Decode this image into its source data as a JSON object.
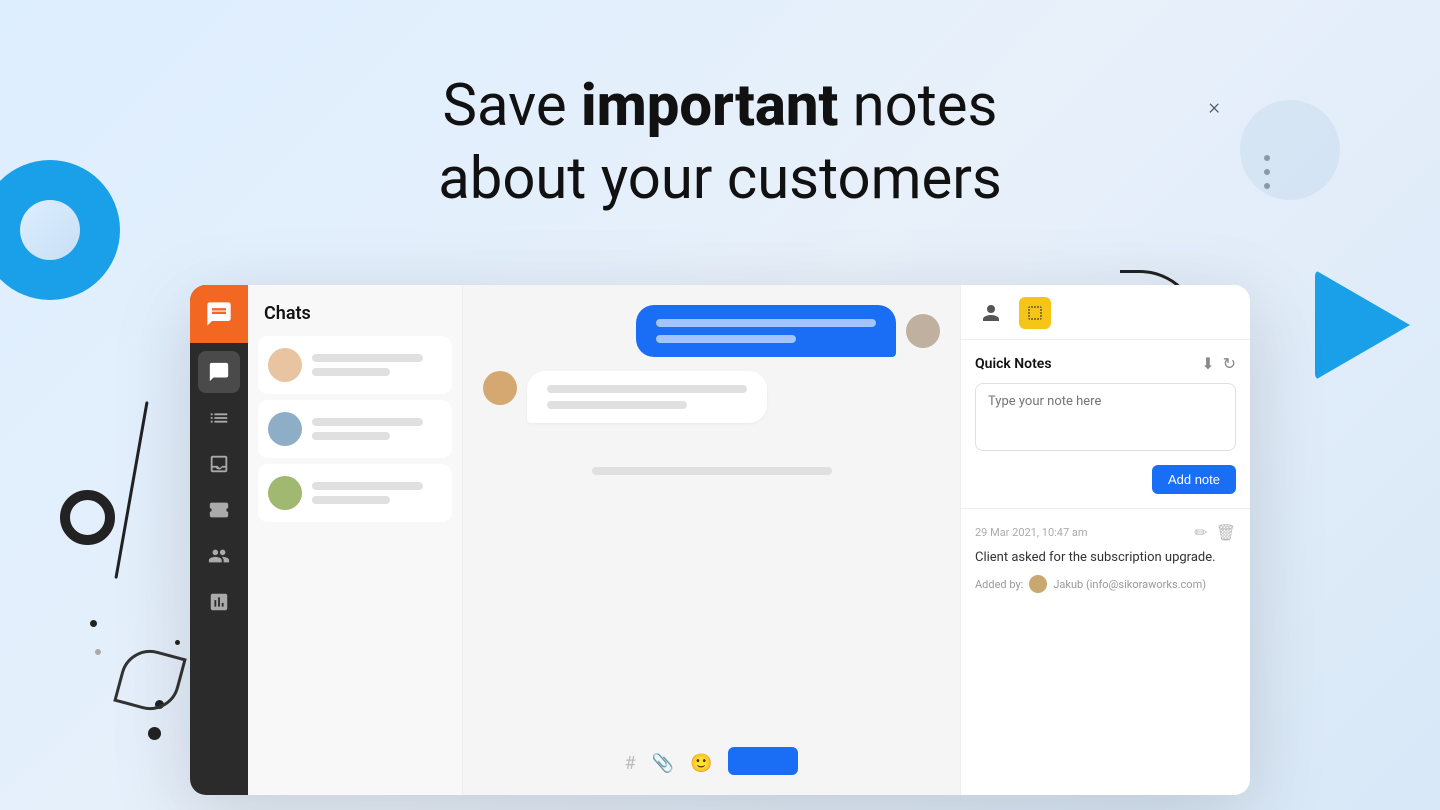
{
  "page": {
    "hero": {
      "line1_plain": "Save ",
      "line1_bold": "important",
      "line1_rest": " notes",
      "line2": "about your customers"
    }
  },
  "sidebar": {
    "logo_icon": "chat-icon",
    "items": [
      {
        "id": "chats",
        "label": "Chats",
        "active": true
      },
      {
        "id": "list",
        "label": "List"
      },
      {
        "id": "inbox",
        "label": "Inbox"
      },
      {
        "id": "tickets",
        "label": "Tickets"
      },
      {
        "id": "contacts",
        "label": "Contacts"
      },
      {
        "id": "analytics",
        "label": "Analytics"
      }
    ]
  },
  "chat_list": {
    "title": "Chats",
    "items": [
      {
        "id": 1,
        "avatar_color": "#e8c4a0"
      },
      {
        "id": 2,
        "avatar_color": "#8eadc7"
      },
      {
        "id": 3,
        "avatar_color": "#a0b8a0"
      }
    ]
  },
  "notes_panel": {
    "quick_notes_title": "Quick Notes",
    "note_placeholder": "Type your note here",
    "add_note_label": "Add note",
    "saved_note": {
      "date": "29 Mar 2021, 10:47 am",
      "text": "Client asked for the subscription upgrade.",
      "added_by_label": "Added by:",
      "author_name": "Jakub (info@sikoraworks.com)"
    }
  }
}
